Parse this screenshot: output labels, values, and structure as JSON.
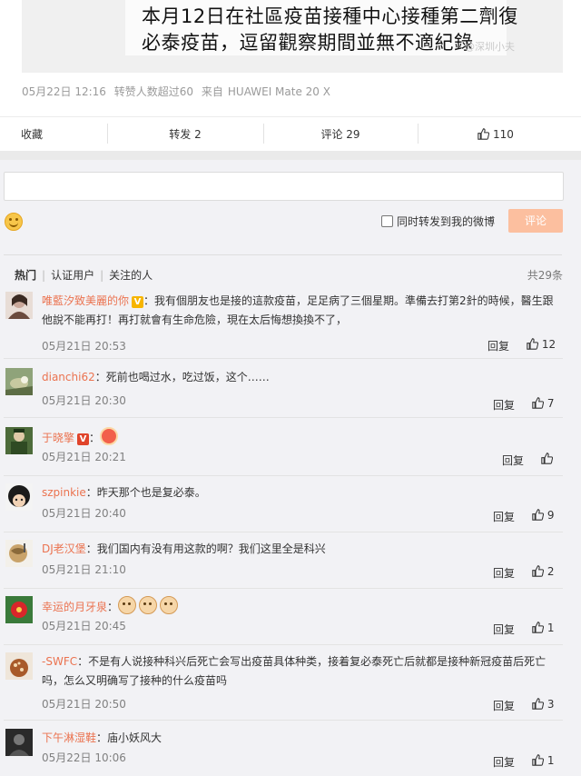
{
  "post": {
    "image_lines": [
      "本月12日在社區疫苗接種中心接種第二劑復",
      "必泰疫苗，逗留觀察期間並無不適紀錄"
    ],
    "watermark": "@深圳小夫",
    "meta": {
      "date": "05月22日 12:16",
      "reposts": "转赞人数超过60",
      "source_prefix": "来自",
      "source": "HUAWEI Mate 20 X"
    },
    "actions": {
      "favorite": "收藏",
      "repost": "转发 2",
      "comment": "评论 29",
      "likes": "110"
    }
  },
  "compose": {
    "placeholder": "",
    "also_repost_label": "同时转发到我的微博",
    "submit_label": "评论"
  },
  "filters": {
    "tabs": [
      "热门",
      "认证用户",
      "关注的人"
    ],
    "total": "共29条"
  },
  "comments": [
    {
      "user": "唯藍汐致美麗的你",
      "text": "：我有個朋友也是接的這款疫苗，足足病了三個星期。準備去打第2針的時候，醫生跟他說不能再打！再打就會有生命危險，現在太后悔想換換不了，",
      "time": "05月21日 20:53",
      "reply": "回复",
      "likes": "12"
    },
    {
      "user": "dianchi62",
      "text": "：死前也喝过水，吃过饭，这个……",
      "time": "05月21日 20:30",
      "reply": "回复",
      "likes": "7"
    },
    {
      "user": "于晓擎",
      "text": "：",
      "time": "05月21日 20:21",
      "reply": "回复",
      "likes": ""
    },
    {
      "user": "szpinkie",
      "text": "：昨天那个也是复必泰。",
      "time": "05月21日 20:40",
      "reply": "回复",
      "likes": "9"
    },
    {
      "user": "DJ老汉堡",
      "text": "：我们国内有没有用这款的啊？我们这里全是科兴",
      "time": "05月21日 21:10",
      "reply": "回复",
      "likes": "2"
    },
    {
      "user": "幸运的月牙泉",
      "text": "：",
      "time": "05月21日 20:45",
      "reply": "回复",
      "likes": "1"
    },
    {
      "user": "-SWFC",
      "text": "：不是有人说接种科兴后死亡会写出疫苗具体种类，接着复必泰死亡后就都是接种新冠疫苗后死亡吗，怎么又明确写了接种的什么疫苗吗",
      "time": "05月21日 20:50",
      "reply": "回复",
      "likes": "3"
    },
    {
      "user": "下午淋湿鞋",
      "text": "：庙小妖风大",
      "time": "05月22日 10:06",
      "reply": "回复",
      "likes": "1"
    }
  ]
}
